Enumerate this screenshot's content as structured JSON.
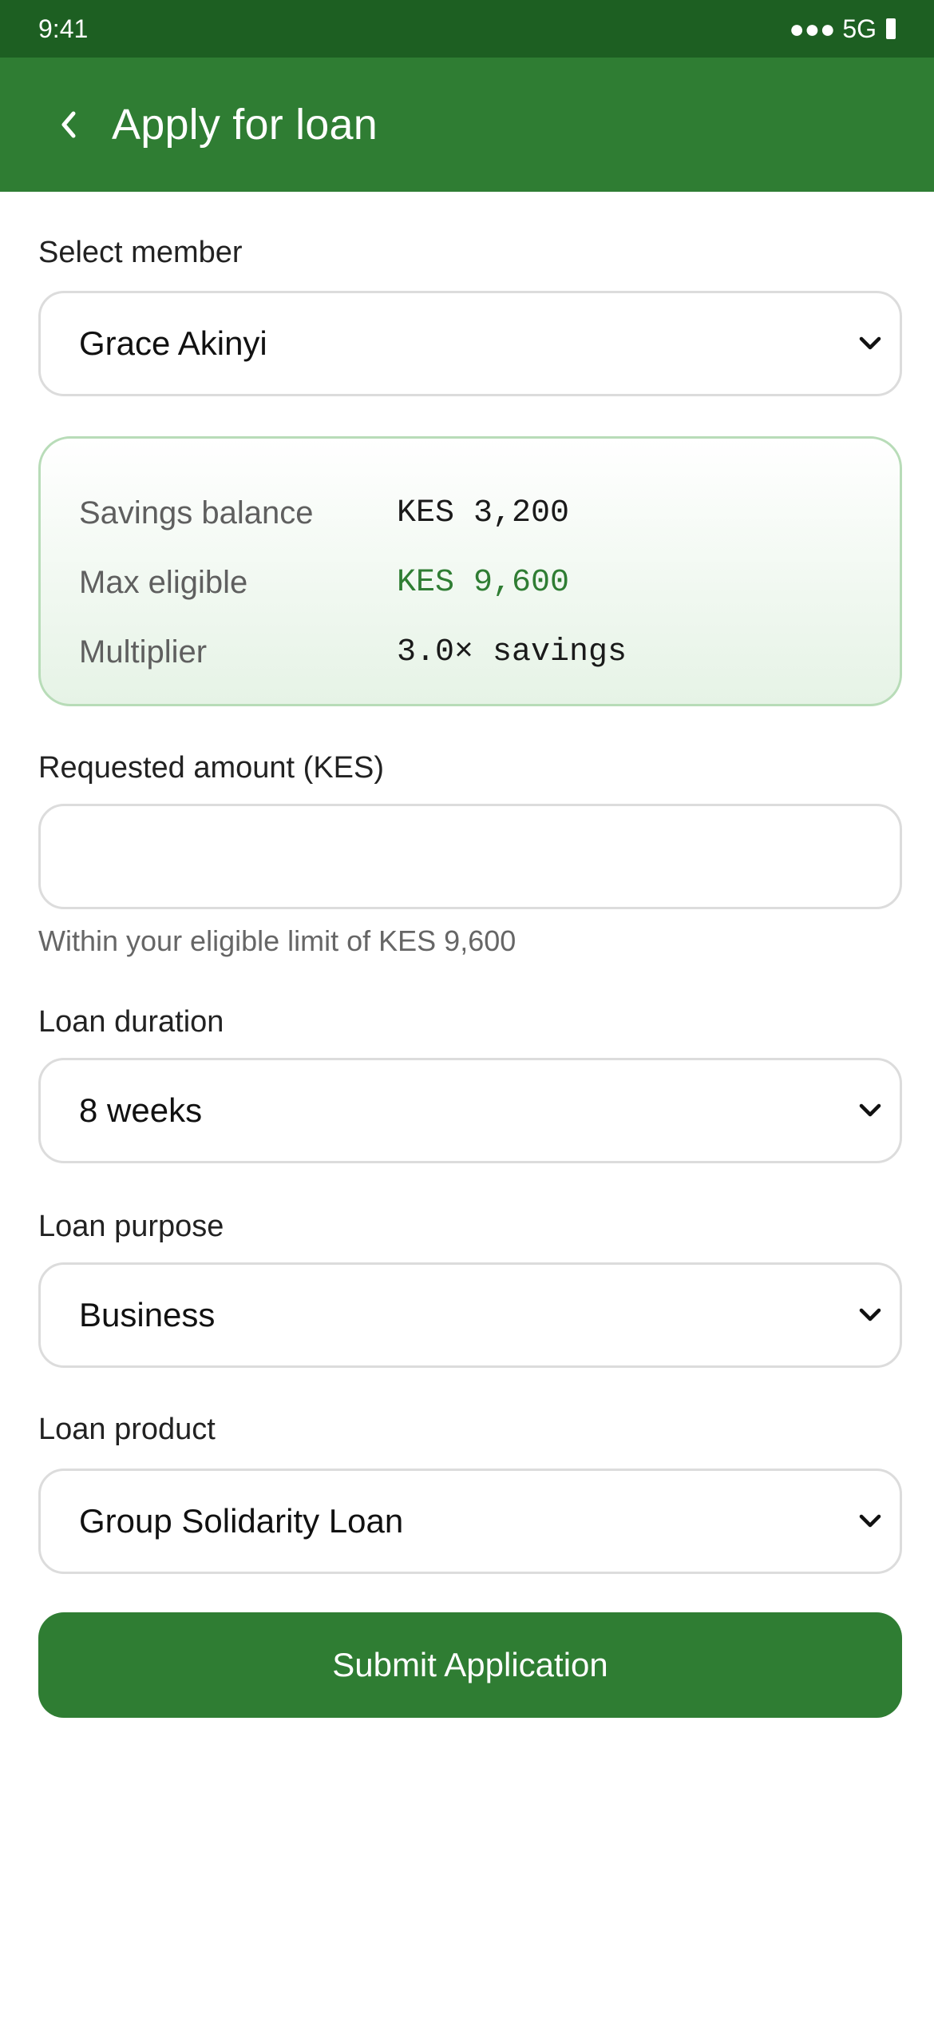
{
  "status_bar": {
    "time": "9:41",
    "signal": "●●● 5G"
  },
  "app_bar": {
    "back_icon": "chevron-left-icon",
    "title": "Apply for loan"
  },
  "form": {
    "member": {
      "label": "Select member",
      "value": "Grace Akinyi"
    },
    "summary": {
      "savings_label": "Savings balance",
      "savings_value": "KES 3,200",
      "max_label": "Max eligible",
      "max_value": "KES 9,600",
      "multiplier_label": "Multiplier",
      "multiplier_value": "3.0× savings"
    },
    "amount": {
      "label": "Requested amount (KES)",
      "value": "",
      "placeholder": "",
      "helper": "Within your eligible limit of KES 9,600"
    },
    "duration": {
      "label": "Loan duration",
      "value": "8 weeks"
    },
    "purpose": {
      "label": "Loan purpose",
      "value": "Business"
    },
    "product": {
      "label": "Loan product",
      "value": "Group Solidarity Loan"
    },
    "submit_label": "Submit Application"
  },
  "colors": {
    "status_bar": "#1d5f22",
    "primary": "#2f7d33",
    "card_border": "#b8dcb8"
  }
}
